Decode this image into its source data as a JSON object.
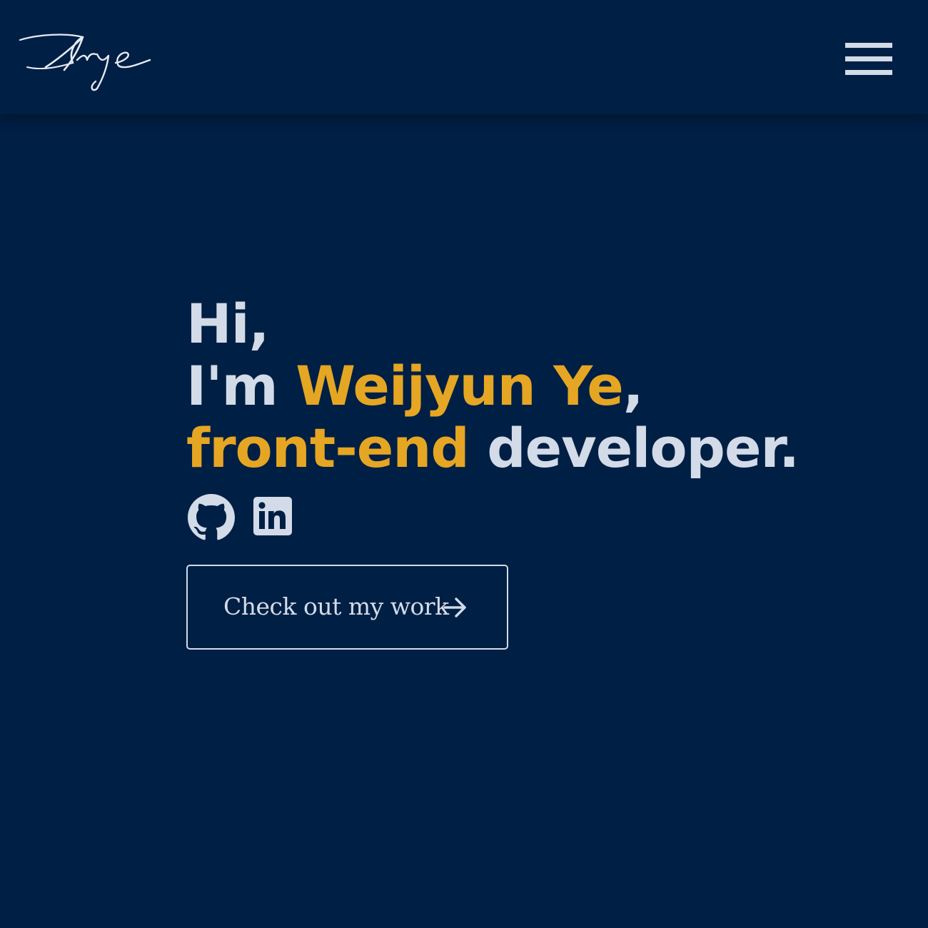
{
  "header": {
    "logo_text": "Arye",
    "menu_icon": "hamburger-menu-icon"
  },
  "hero": {
    "greeting": "Hi,",
    "intro_prefix": "I'm ",
    "name": "Weijyun Ye",
    "intro_suffix": ",",
    "role": "front-end",
    "role_suffix": " developer."
  },
  "socials": [
    {
      "icon": "github-icon"
    },
    {
      "icon": "linkedin-icon"
    }
  ],
  "cta": {
    "label": "Check out my work",
    "icon": "arrow-right-icon"
  },
  "colors": {
    "background": "#001f44",
    "text": "#d3dbe8",
    "accent": "#e5a623"
  }
}
